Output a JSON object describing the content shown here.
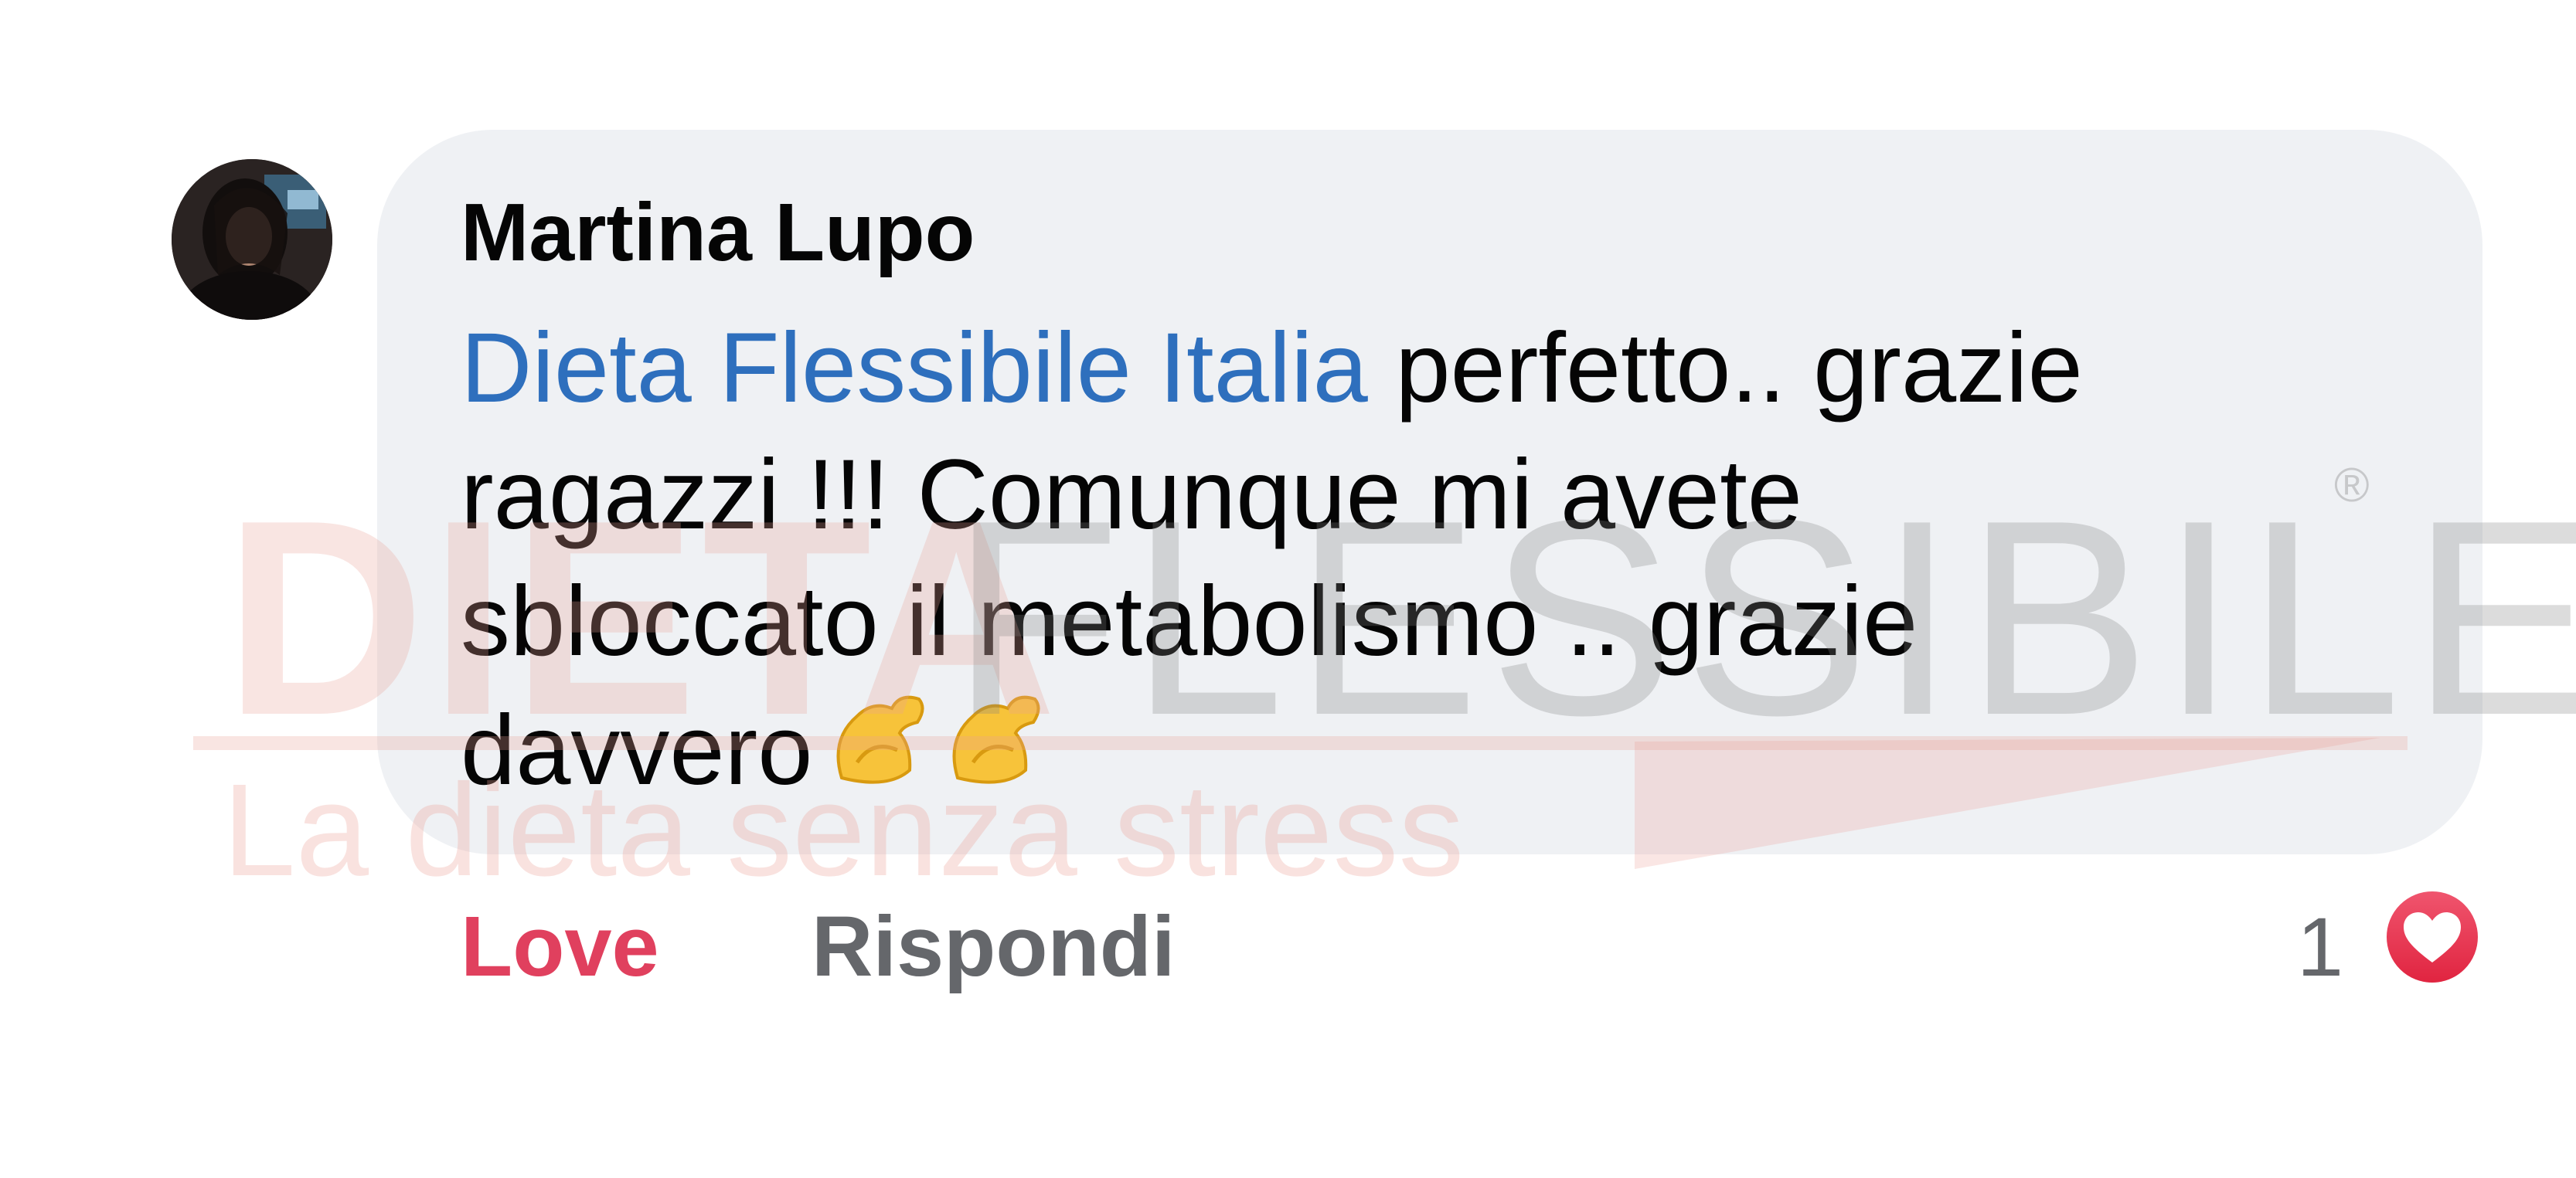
{
  "comment": {
    "author": "Martina Lupo",
    "mention": "Dieta Flessibile Italia",
    "text_lines": [
      " perfetto.. grazie",
      "ragazzi !!! Comunque mi avete",
      "sbloccato il metabolismo .. grazie",
      "davvero"
    ],
    "emoji": "flexed-biceps-icon",
    "mention_color": "#2e6fbd"
  },
  "actions": {
    "love_label": "Love",
    "love_color": "#e0405e",
    "reply_label": "Rispondi"
  },
  "reactions": {
    "count": "1",
    "icon": "heart-reaction-icon"
  },
  "watermark": {
    "word1": "DIETA",
    "word2": "FLESSIBILE",
    "registered": "®",
    "tagline": "La dieta senza stress"
  }
}
